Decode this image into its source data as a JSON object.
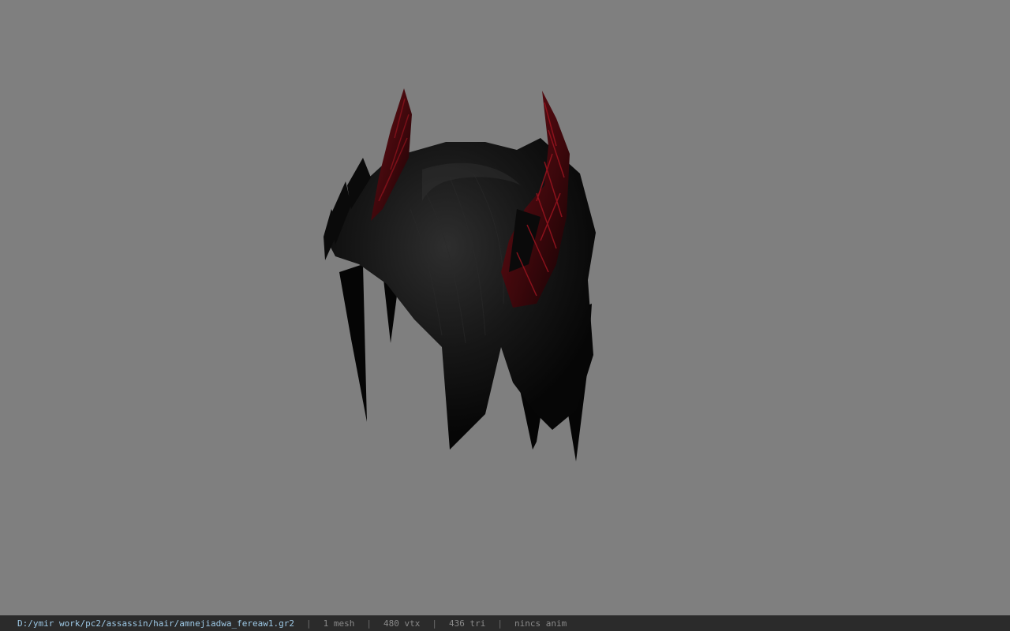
{
  "viewport": {
    "background": "#7f7f7f",
    "model_name": "hair-model"
  },
  "status_bar": {
    "file_path": "D:/ymir work/pc2/assassin/hair/amnejiadwa_fereaw1.gr2",
    "separator": "|",
    "mesh_count": "1 mesh",
    "vertex_count": "480 vtx",
    "triangle_count": "436 tri",
    "animation": "nincs anim",
    "path_color": "#9ec9e6",
    "text_color": "#8a8a8a"
  }
}
